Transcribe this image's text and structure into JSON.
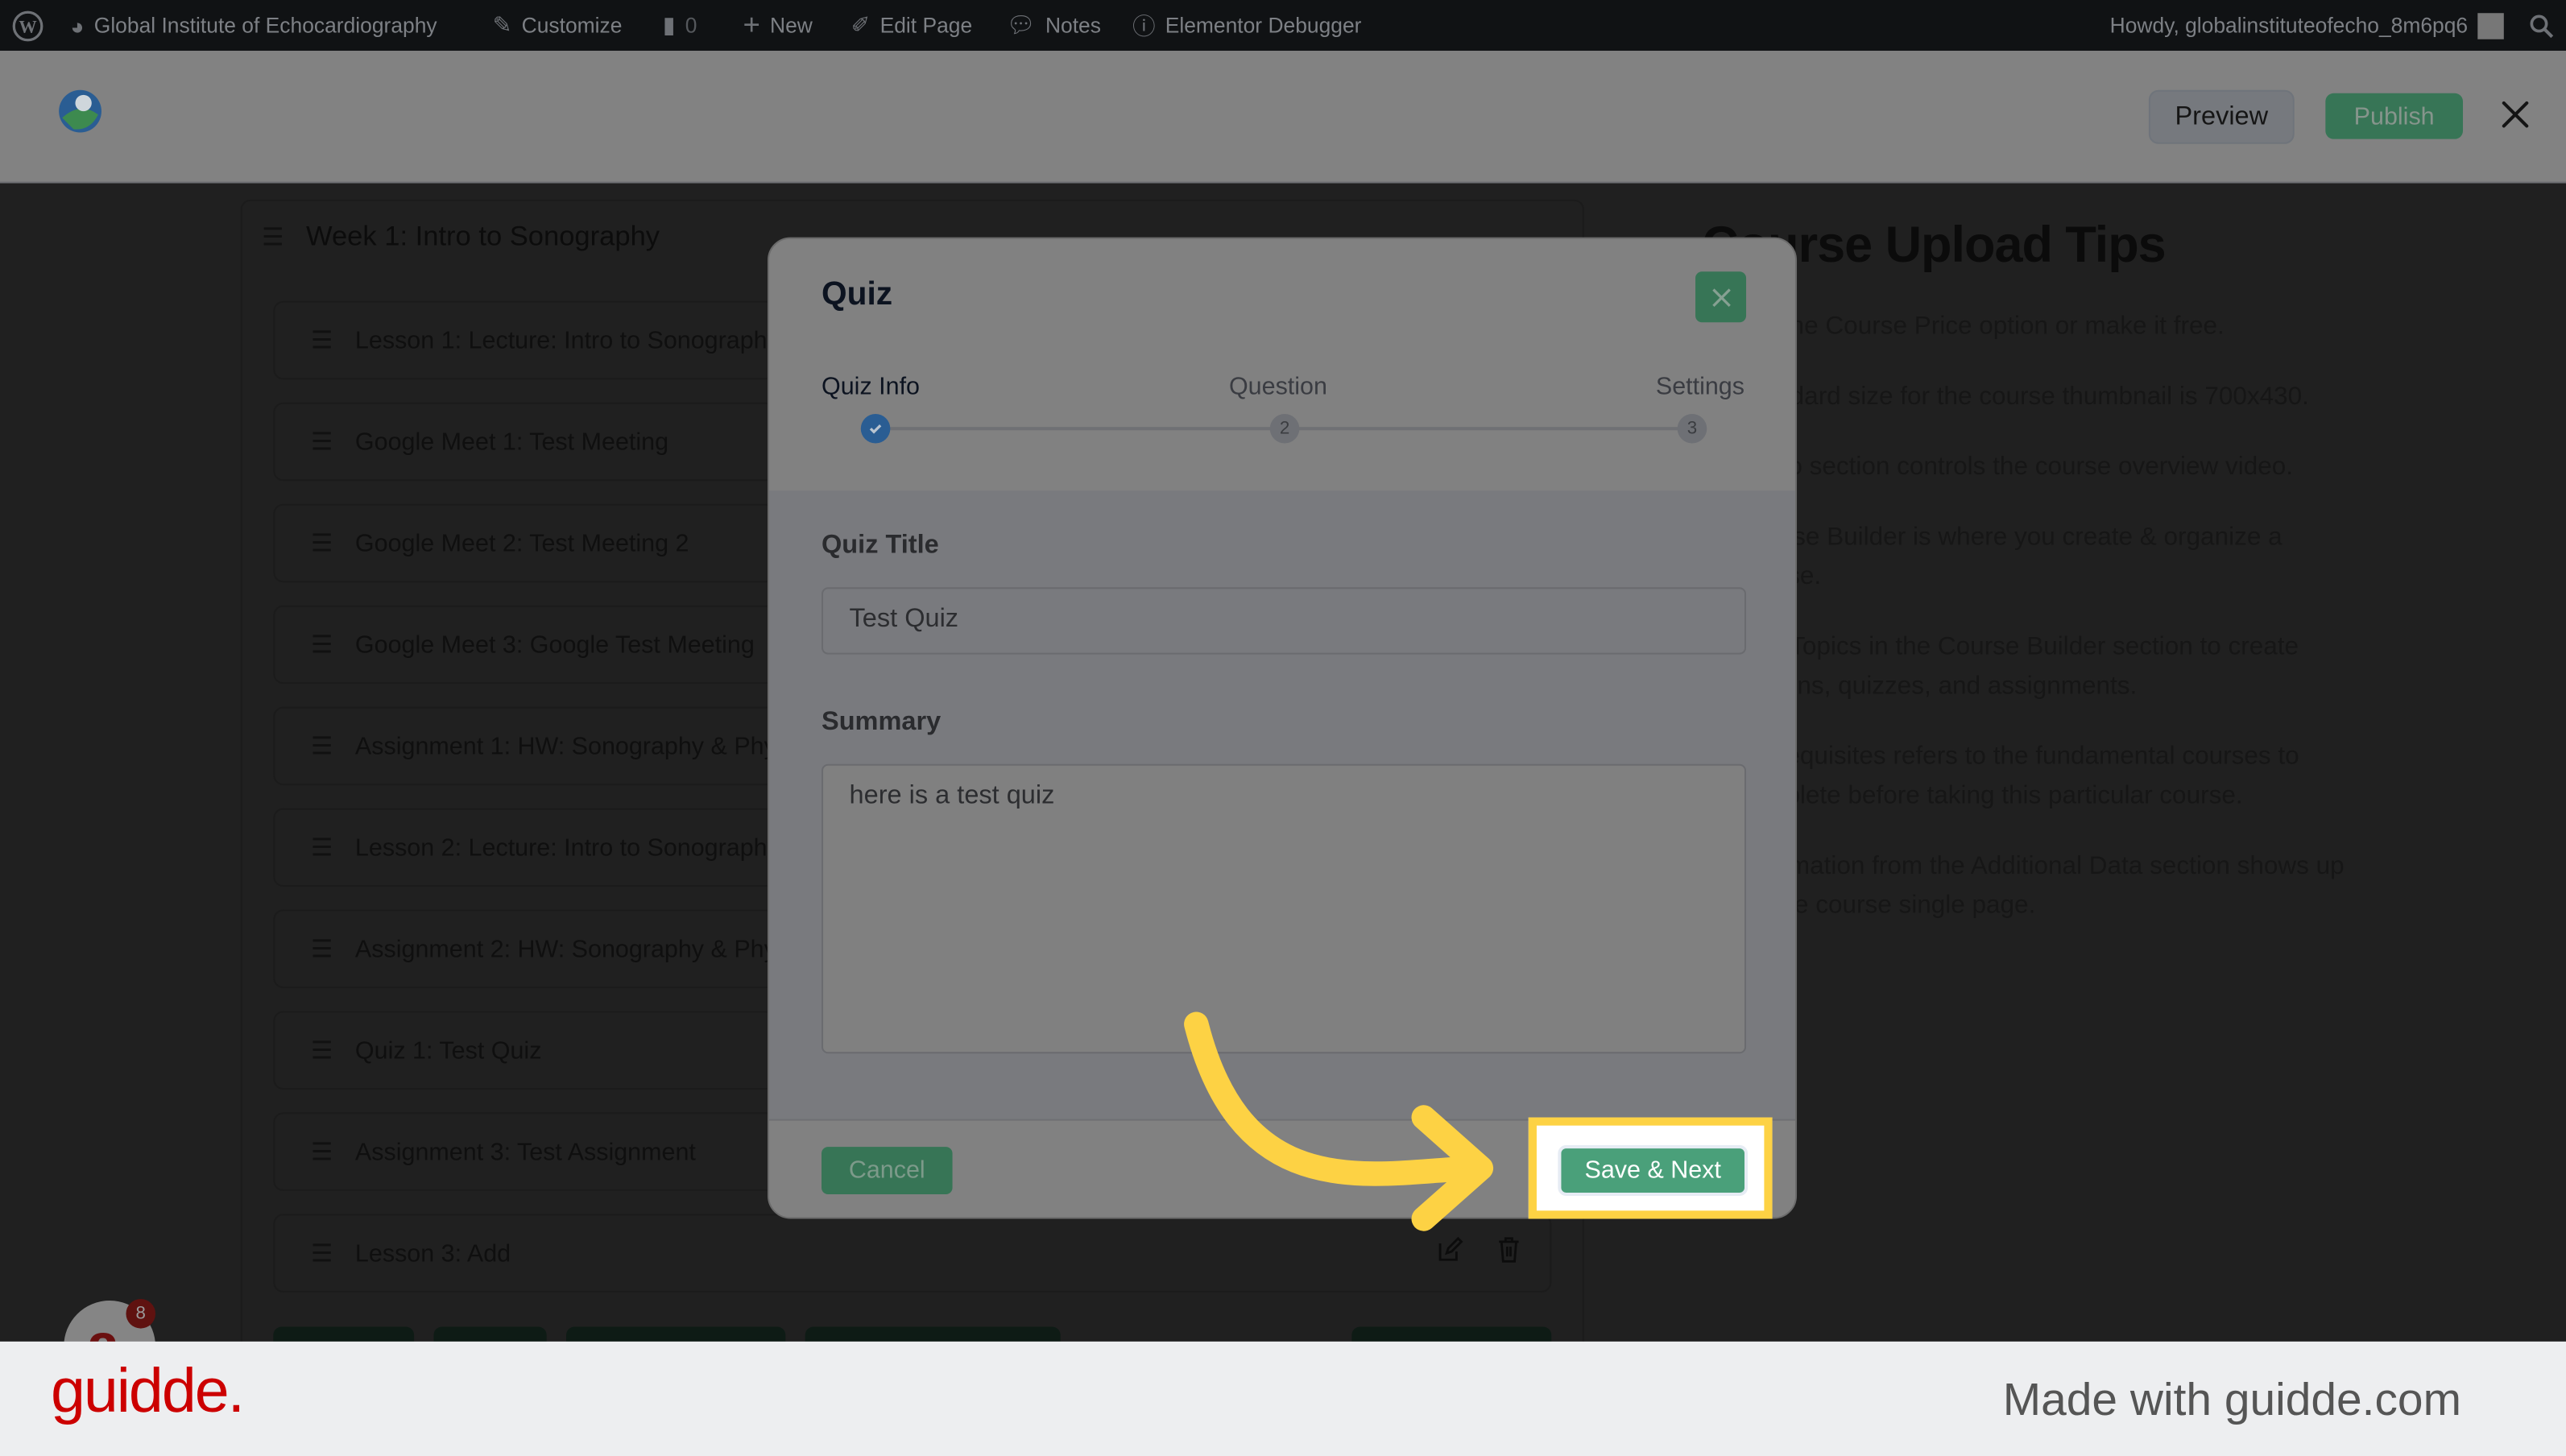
{
  "admin_bar": {
    "site_name": "Global Institute of Echocardiography",
    "customize": "Customize",
    "comments_count": "0",
    "new": "New",
    "edit_page": "Edit Page",
    "notes": "Notes",
    "debugger": "Elementor Debugger",
    "howdy": "Howdy, globalinstituteofecho_8m6pq6"
  },
  "header": {
    "preview": "Preview",
    "publish": "Publish"
  },
  "builder": {
    "topic_title": "Week 1: Intro to Sonography",
    "items": [
      "Lesson 1: Lecture: Intro to Sonography",
      "Google Meet 1: Test Meeting",
      "Google Meet 2: Test Meeting 2",
      "Google Meet 3: Google Test Meeting",
      "Assignment 1: HW: Sonography & Physics",
      "Lesson 2: Lecture: Intro to Sonography",
      "Assignment 2: HW: Sonography & Physics",
      "Quiz 1: Test Quiz",
      "Assignment 3: Test Assignment",
      "Lesson 3: Add"
    ]
  },
  "tips": {
    "title": "Course Upload Tips",
    "items": [
      "Set the Course Price option or make it free.",
      "Standard size for the course thumbnail is 700x430.",
      "Video section controls the course overview video.",
      "Course Builder is where you create & organize a course.",
      "Add Topics in the Course Builder section to create lessons, quizzes, and assignments.",
      "Prerequisites refers to the fundamental courses to complete before taking this particular course.",
      "Information from the Additional Data section shows up on the course single page."
    ]
  },
  "modal": {
    "title": "Quiz",
    "steps": [
      {
        "label": "Quiz Info",
        "number": "1",
        "status": "complete"
      },
      {
        "label": "Question",
        "number": "2",
        "status": "pending"
      },
      {
        "label": "Settings",
        "number": "3",
        "status": "pending"
      }
    ],
    "quiz_title_label": "Quiz Title",
    "quiz_title_value": "Test Quiz",
    "summary_label": "Summary",
    "summary_value": "here is a test quiz",
    "cancel": "Cancel",
    "save_next": "Save & Next"
  },
  "notification_badge": "8",
  "footer": {
    "brand": "guidde.",
    "made_with": "Made with guidde.com"
  },
  "colors": {
    "accent_green": "#4aa07a",
    "highlight_yellow": "#fdd244",
    "brand_red": "#cc0000",
    "step_blue": "#2a5d93"
  }
}
